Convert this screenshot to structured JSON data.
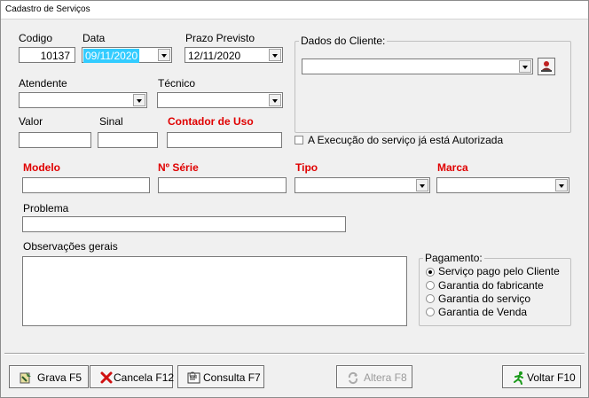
{
  "window": {
    "title": "Cadastro de Serviços"
  },
  "form": {
    "codigo": {
      "label": "Codigo",
      "value": "10137"
    },
    "data": {
      "label": "Data",
      "value": "09/11/2020"
    },
    "prazo": {
      "label": "Prazo Previsto",
      "value": "12/11/2020"
    },
    "atendente": {
      "label": "Atendente",
      "value": ""
    },
    "tecnico": {
      "label": "Técnico",
      "value": ""
    },
    "valor": {
      "label": "Valor",
      "value": ""
    },
    "sinal": {
      "label": "Sinal",
      "value": ""
    },
    "contador": {
      "label": "Contador de Uso",
      "value": ""
    },
    "modelo": {
      "label": "Modelo",
      "value": ""
    },
    "serie": {
      "label": "Nº Série",
      "value": ""
    },
    "tipo": {
      "label": "Tipo",
      "value": ""
    },
    "marca": {
      "label": "Marca",
      "value": ""
    },
    "problema": {
      "label": "Problema",
      "value": ""
    },
    "observacoes": {
      "label": "Observações gerais",
      "value": ""
    }
  },
  "cliente": {
    "group_title": "Dados do Cliente:",
    "value": ""
  },
  "autorizada": {
    "label": "A Execução do serviço já está Autorizada",
    "checked": false
  },
  "pagamento": {
    "title": "Pagamento:",
    "options": [
      {
        "label": "Serviço pago pelo Cliente",
        "selected": true
      },
      {
        "label": "Garantia do fabricante",
        "selected": false
      },
      {
        "label": "Garantia do serviço",
        "selected": false
      },
      {
        "label": "Garantia de Venda",
        "selected": false
      }
    ]
  },
  "buttons": {
    "grava": "Grava F5",
    "cancela": "Cancela F12",
    "consulta": "Consulta F7",
    "altera": "Altera F8",
    "voltar": "Voltar F10"
  },
  "icons": {
    "grava": "save-icon",
    "cancela": "cancel-x-icon",
    "consulta": "search-list-icon",
    "altera": "edit-refresh-icon",
    "voltar": "running-man-icon",
    "cliente": "person-lookup-icon"
  },
  "colors": {
    "required_label": "#e00000",
    "selection": "#33ccff"
  }
}
